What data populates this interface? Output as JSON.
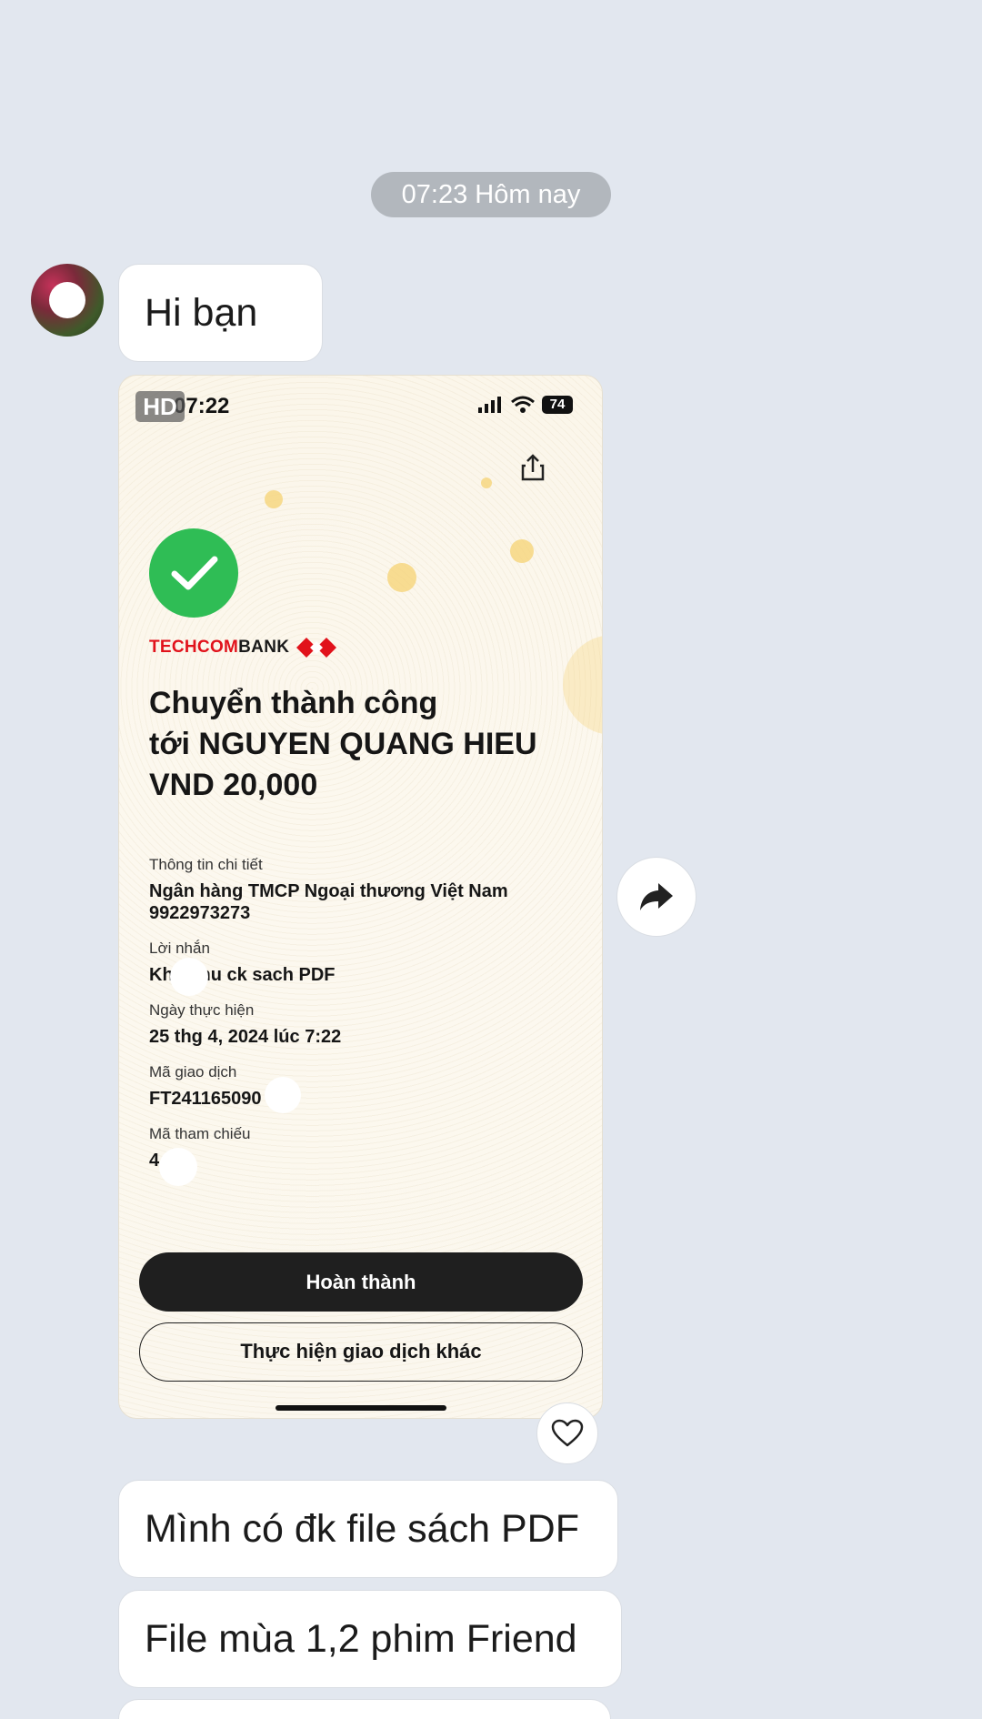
{
  "timestamp_pill": "07:23 Hôm nay",
  "messages": [
    {
      "text": "Hi bạn"
    },
    {
      "text": "Mình có đk file sách PDF"
    },
    {
      "text": "File mùa 1,2 phim Friend"
    }
  ],
  "photo": {
    "badge": "HD",
    "status_time": "07:22",
    "battery": "74",
    "bank_name": {
      "red": "TECHCOM",
      "dark": "BANK"
    },
    "headline_lines": [
      "Chuyển thành công",
      "tới NGUYEN QUANG HIEU",
      "VND 20,000"
    ],
    "details": {
      "info_label": "Thông tin chi tiết",
      "bank_line": "Ngân hàng TMCP Ngoại thương Việt Nam",
      "account": "9922973273",
      "message_label": "Lời nhắn",
      "message_value": "Khan    hu ck sach PDF",
      "date_label": "Ngày thực hiện",
      "date_value": "25 thg 4, 2024 lúc 7:22",
      "txn_label": "Mã giao dịch",
      "txn_value": "FT241165090    390",
      "ref_label": "Mã tham chiếu",
      "ref_value": "4    25"
    },
    "primary_button": "Hoàn thành",
    "secondary_button": "Thực hiện giao dịch khác"
  },
  "icons": {
    "forward": "forward-arrow-icon",
    "like": "heart-icon",
    "share": "share-icon",
    "check": "checkmark-icon"
  },
  "colors": {
    "background": "#e2e7ef",
    "success_green": "#2fbd55",
    "techcombank_red": "#e1121b"
  }
}
